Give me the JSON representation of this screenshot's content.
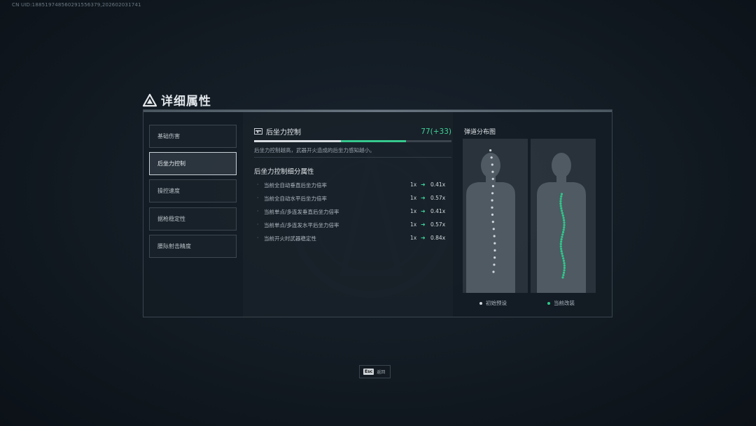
{
  "uid": "CN UID:18851974856029155637​9,202602031741",
  "header": {
    "title": "详细属性"
  },
  "nav": {
    "items": [
      {
        "label": "基础伤害"
      },
      {
        "label": "后坐力控制"
      },
      {
        "label": "操控速度"
      },
      {
        "label": "据枪稳定性"
      },
      {
        "label": "腰际射击精度"
      }
    ],
    "active_index": 1
  },
  "stat": {
    "name": "后坐力控制",
    "value": "77(+33)",
    "base_fraction": 0.44,
    "current_fraction": 0.77,
    "description": "后坐力控制越高，武器开火造成的后坐力感知越小。",
    "sub_title": "后坐力控制细分属性",
    "rows": [
      {
        "bullet": "·",
        "label": "当前全自动垂直后坐力倍率",
        "from": "1x",
        "to": "0.41x"
      },
      {
        "bullet": "·",
        "label": "当前全自动水平后坐力倍率",
        "from": "1x",
        "to": "0.57x"
      },
      {
        "bullet": "·",
        "label": "当前单点/多连发垂直后坐力倍率",
        "from": "1x",
        "to": "0.41x"
      },
      {
        "bullet": "·",
        "label": "当前单点/多连发水平后坐力倍率",
        "from": "1x",
        "to": "0.57x"
      },
      {
        "bullet": "·",
        "label": "当前开火时武器稳定性",
        "from": "1x",
        "to": "0.84x"
      }
    ]
  },
  "spread": {
    "title": "弹道分布图",
    "legend_initial": "初始预设",
    "legend_current": "当前改装",
    "colors": {
      "initial": "#d0d5da",
      "current": "#2fc88a"
    }
  },
  "footer": {
    "key": "Esc",
    "label": "返回"
  },
  "colors": {
    "accent_green": "#3fd29a",
    "panel_border": "#3a454f"
  }
}
